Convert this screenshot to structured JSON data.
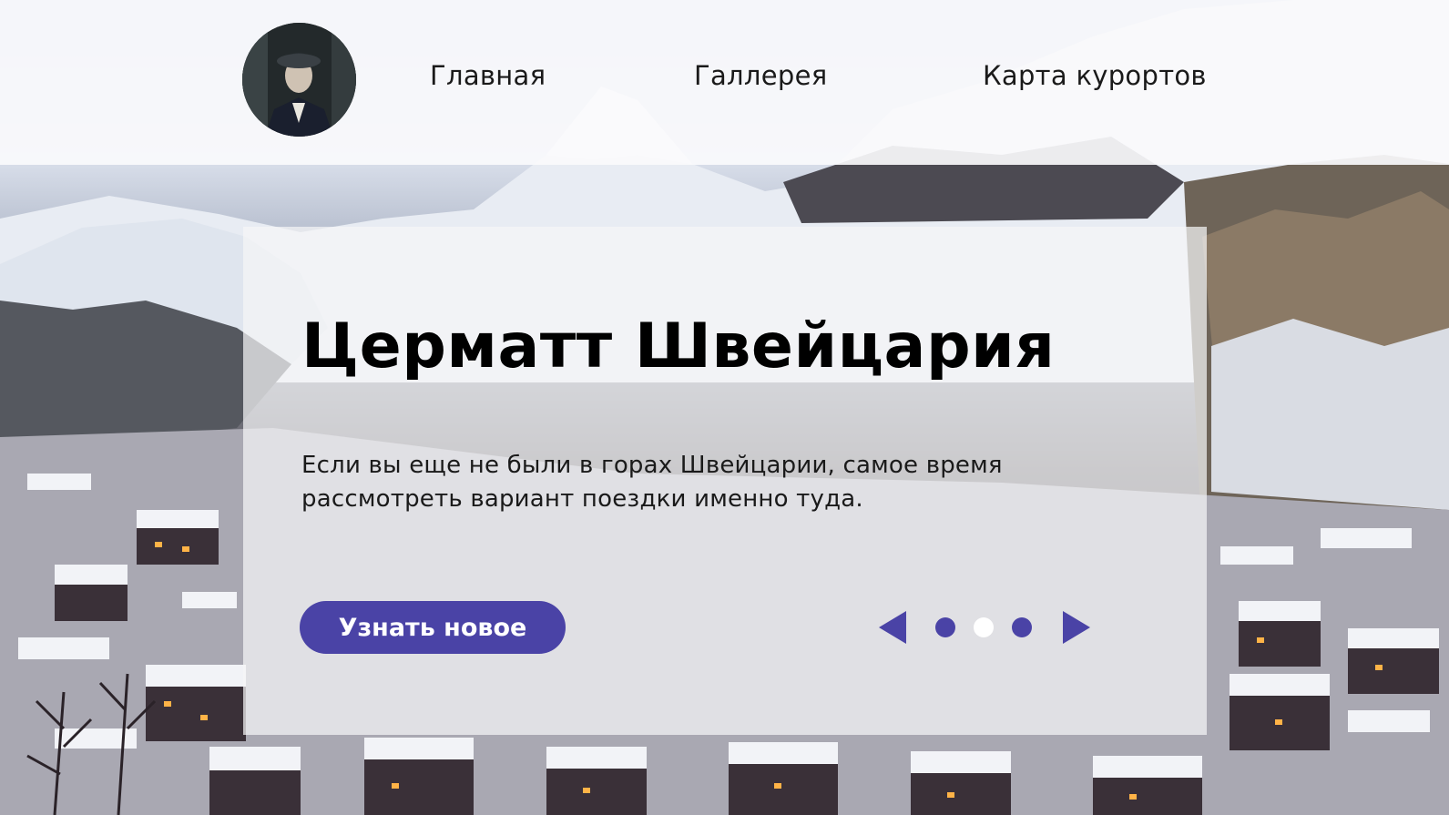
{
  "nav": {
    "items": [
      {
        "label": "Главная"
      },
      {
        "label": "Галлерея"
      },
      {
        "label": "Карта курортов"
      }
    ]
  },
  "hero": {
    "title": "Церматт Швейцария",
    "description": "Если вы еще не были в горах Швейцарии, самое время рассмотреть вариант поездки именно туда.",
    "cta_label": "Узнать новое"
  },
  "slider": {
    "total_slides": 3,
    "active_slide": 2
  },
  "colors": {
    "accent": "#4a43a6",
    "card_background": "#f5f5f7",
    "active_dot": "#ffffff"
  },
  "icons": {
    "prev": "triangle-left-icon",
    "next": "triangle-right-icon"
  }
}
